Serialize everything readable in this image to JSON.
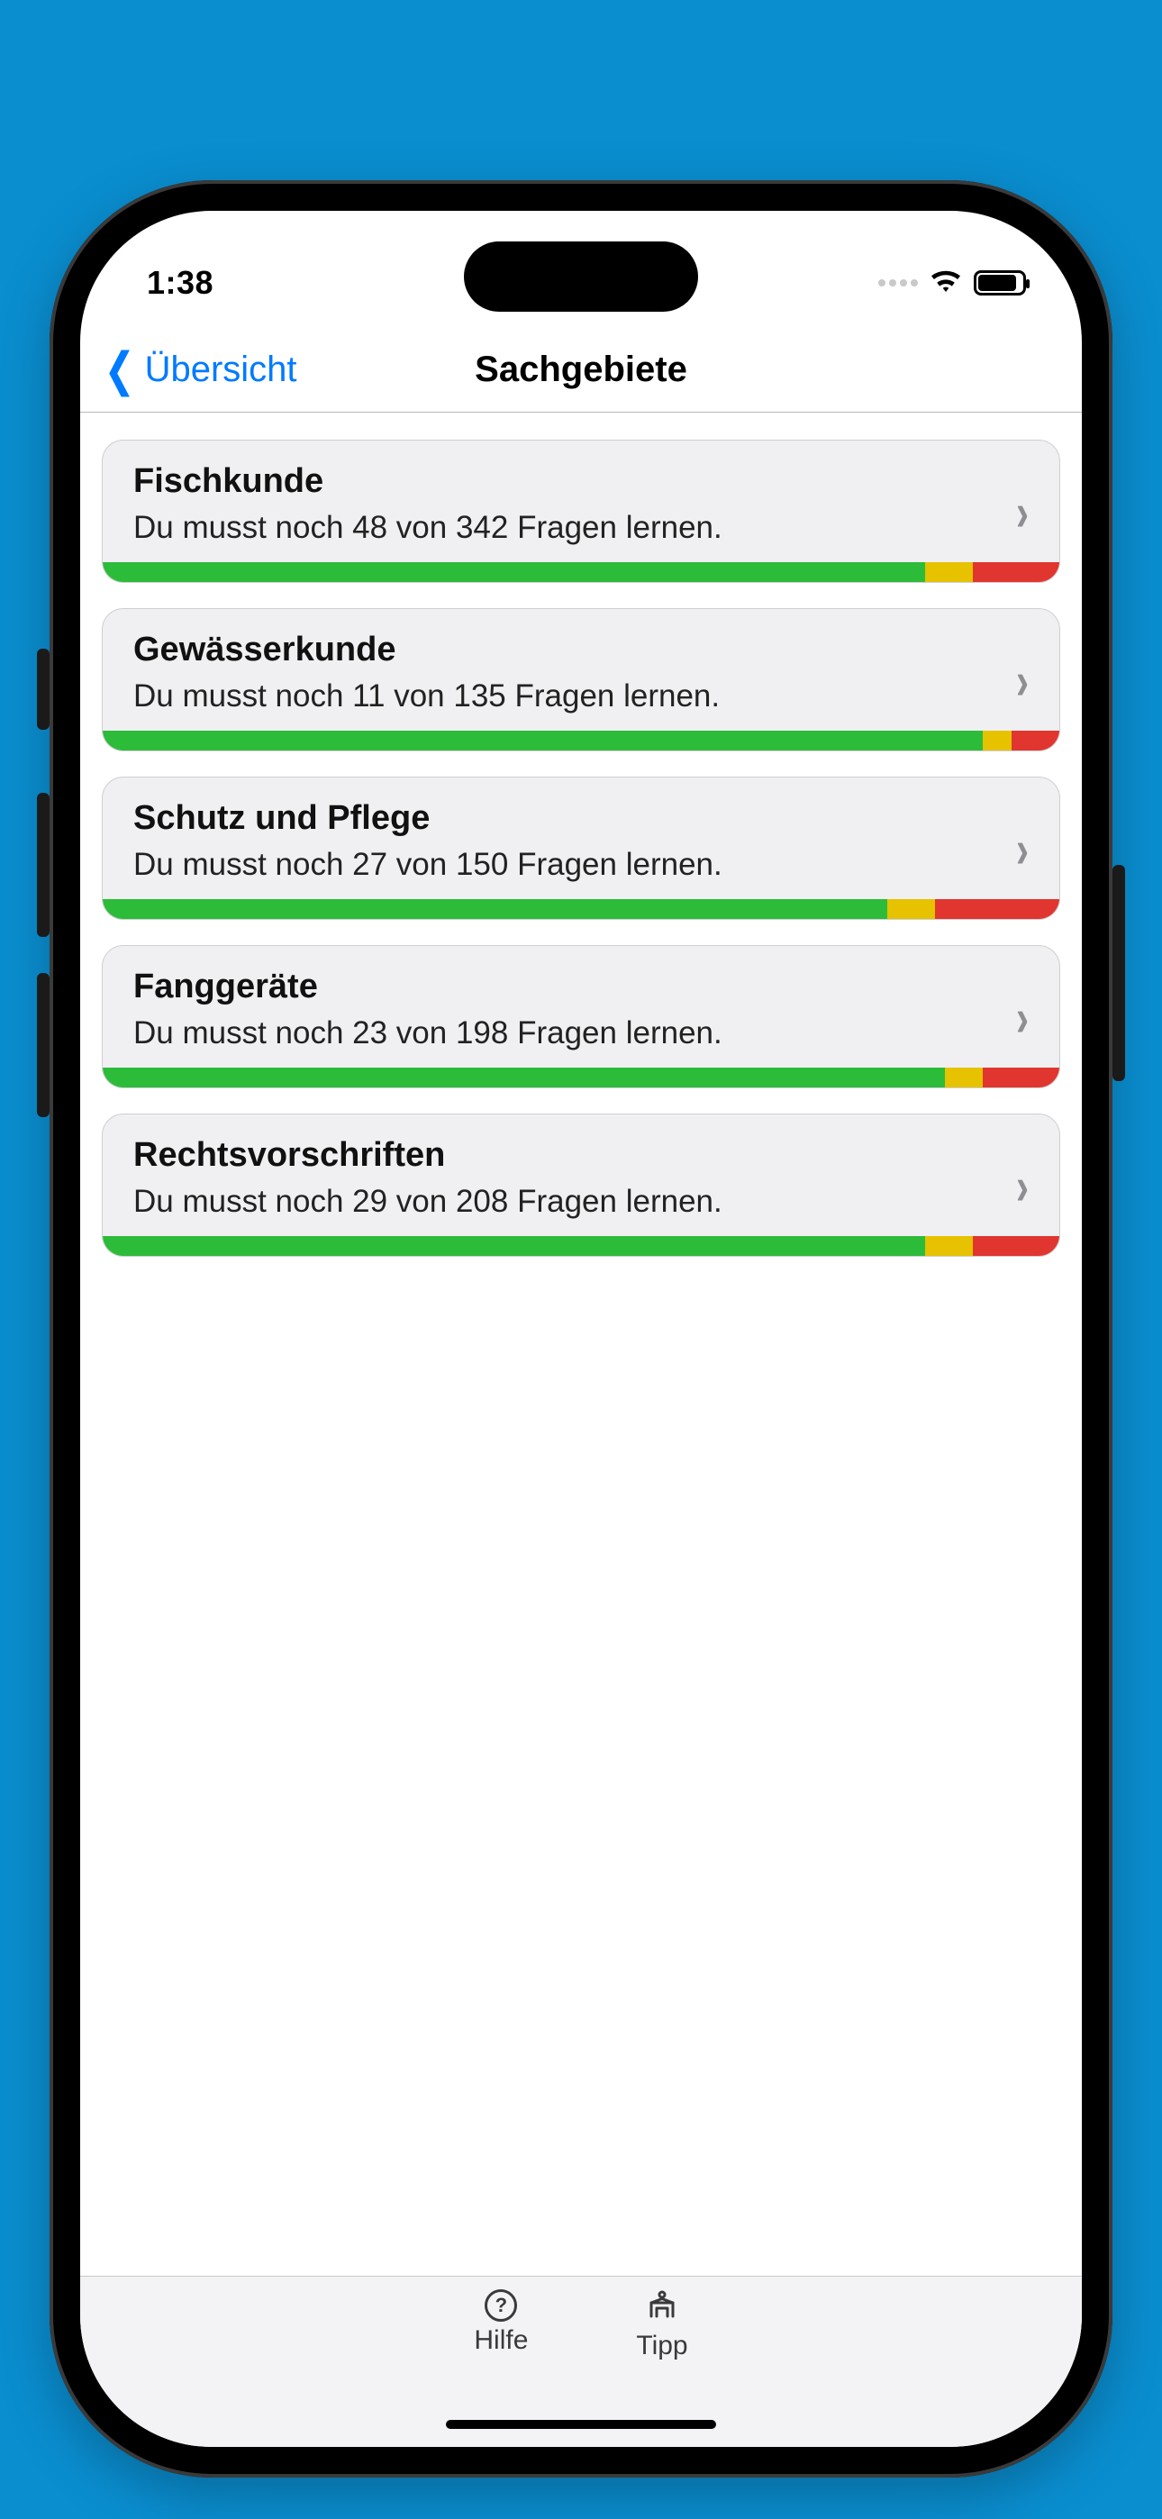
{
  "status": {
    "time": "1:38"
  },
  "nav": {
    "back_label": "Übersicht",
    "title": "Sachgebiete"
  },
  "subjects": [
    {
      "title": "Fischkunde",
      "subtitle": "Du musst noch 48 von 342 Fragen lernen.",
      "remaining": 48,
      "total": 342,
      "progress": {
        "green": 86,
        "yellow": 5,
        "red": 9
      }
    },
    {
      "title": "Gewässerkunde",
      "subtitle": "Du musst noch 11 von 135 Fragen lernen.",
      "remaining": 11,
      "total": 135,
      "progress": {
        "green": 92,
        "yellow": 3,
        "red": 5
      }
    },
    {
      "title": "Schutz und Pflege",
      "subtitle": "Du musst noch 27 von 150 Fragen lernen.",
      "remaining": 27,
      "total": 150,
      "progress": {
        "green": 82,
        "yellow": 5,
        "red": 13
      }
    },
    {
      "title": "Fanggeräte",
      "subtitle": "Du musst noch 23 von 198 Fragen lernen.",
      "remaining": 23,
      "total": 198,
      "progress": {
        "green": 88,
        "yellow": 4,
        "red": 8
      }
    },
    {
      "title": "Rechtsvorschriften",
      "subtitle": "Du musst noch 29 von 208 Fragen lernen.",
      "remaining": 29,
      "total": 208,
      "progress": {
        "green": 86,
        "yellow": 5,
        "red": 9
      }
    }
  ],
  "tabbar": {
    "help_label": "Hilfe",
    "tip_label": "Tipp"
  }
}
